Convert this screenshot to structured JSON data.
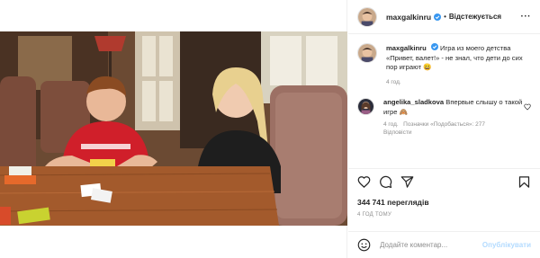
{
  "post": {
    "username": "maxgalkinru",
    "follow_state": "Відстежується",
    "caption_text": "Игра из моего детства «Привет, валет!» - не знал, что дети до сих пор играют 😄",
    "caption_time": "4 год."
  },
  "comment": {
    "username": "angelika_sladkova",
    "text": "Впервые слышу о такой игре 🙈",
    "time": "4 год.",
    "likes": "Позначки «Подобається»: 277",
    "reply": "Відповісти"
  },
  "stats": {
    "views": "344 741 переглядів",
    "time_ago": "4 ГОД ТОМУ"
  },
  "composer": {
    "placeholder": "Додайте коментар...",
    "publish_label": "Опублікувати"
  },
  "icons": {
    "verified": "verified-badge-icon",
    "more": "more-options-icon",
    "like": "heart-icon",
    "comment": "comment-bubble-icon",
    "share": "paper-plane-icon",
    "save": "bookmark-icon",
    "emoji": "emoji-smile-icon"
  },
  "colors": {
    "verified_blue": "#3897f0",
    "publish_disabled": "#b3dbff",
    "meta_gray": "#8e8e8e"
  }
}
